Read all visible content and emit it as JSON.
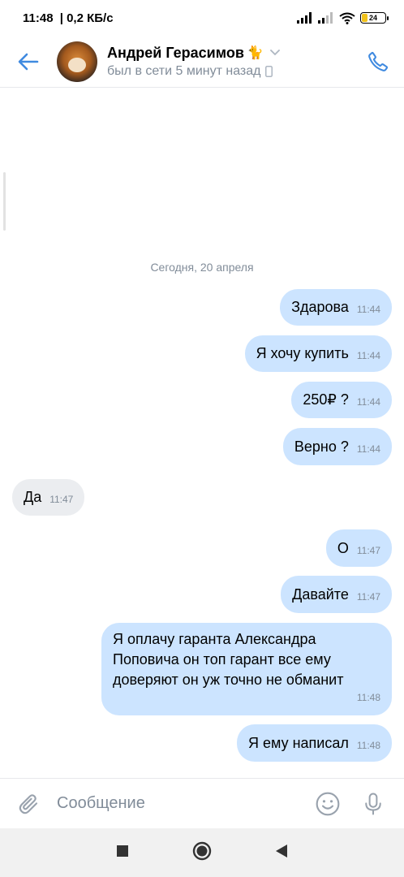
{
  "status_bar": {
    "time": "11:48",
    "speed": "| 0,2 КБ/с",
    "battery": "24",
    "battery_level": 0.24
  },
  "header": {
    "name": "Андрей Герасимов",
    "name_emoji": "🐈",
    "status": "был в сети 5 минут назад"
  },
  "chat": {
    "date": "Сегодня, 20 апреля",
    "messages": [
      {
        "dir": "out",
        "text": "Здарова",
        "time": "11:44"
      },
      {
        "dir": "out",
        "text": "Я хочу купить",
        "time": "11:44"
      },
      {
        "dir": "out",
        "text": "250₽ ?",
        "time": "11:44"
      },
      {
        "dir": "out",
        "text": "Верно ?",
        "time": "11:44"
      },
      {
        "dir": "in",
        "text": "Да",
        "time": "11:47"
      },
      {
        "dir": "out",
        "text": "О",
        "time": "11:47"
      },
      {
        "dir": "out",
        "text": "Давайте",
        "time": "11:47"
      },
      {
        "dir": "out",
        "text": "Я оплачу гаранта Александра Поповича он топ гарант все ему доверяют он уж точно не обманит",
        "time": "11:48"
      },
      {
        "dir": "out",
        "text": "Я ему написал",
        "time": "11:48"
      }
    ]
  },
  "input": {
    "placeholder": "Сообщение"
  },
  "colors": {
    "accent": "#3f8ae0",
    "outgoing_bubble": "#cce4ff",
    "incoming_bubble": "#ebedf0",
    "secondary_text": "#818c99"
  },
  "icons": [
    "back-arrow-icon",
    "phone-icon",
    "chevron-down-icon",
    "mobile-device-icon",
    "paperclip-icon",
    "emoji-icon",
    "microphone-icon",
    "nav-square-icon",
    "nav-circle-icon",
    "nav-back-icon"
  ]
}
